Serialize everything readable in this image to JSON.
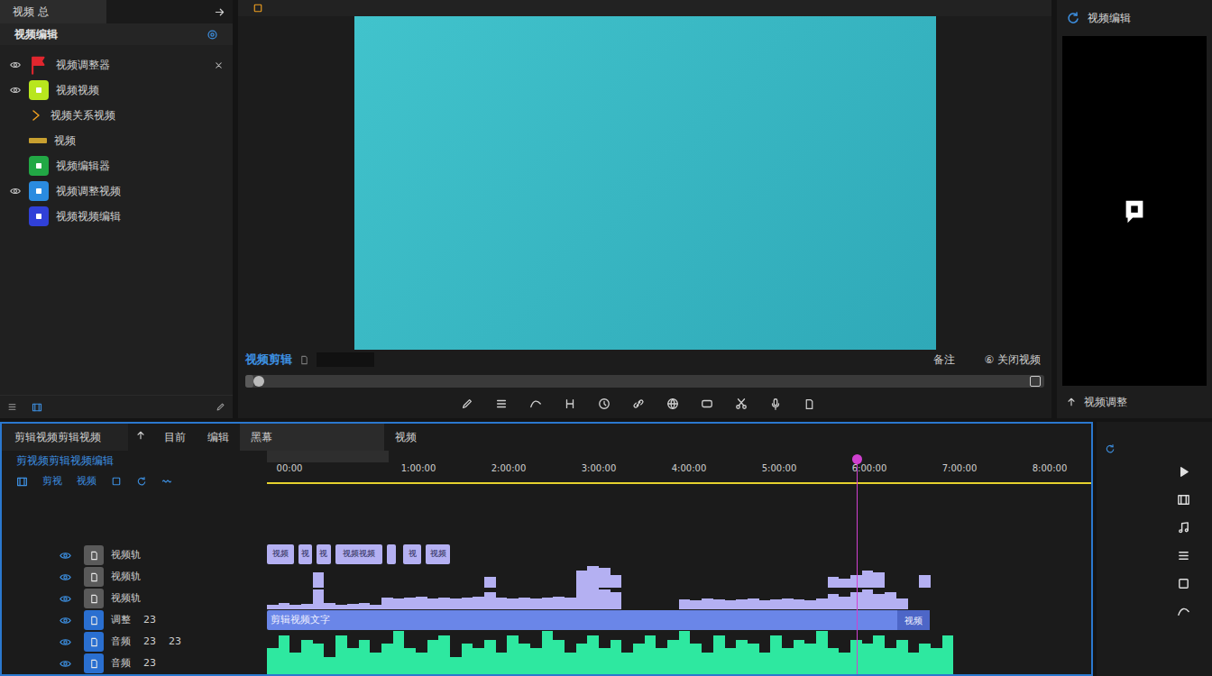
{
  "project_panel": {
    "tab": "视频 总",
    "title": "视频编辑",
    "items": [
      {
        "label": "视频调整器",
        "kind": "flag",
        "color": "#e0262e",
        "visible": true,
        "closable": true
      },
      {
        "label": "视频视频",
        "kind": "badge",
        "color": "#b8e61e",
        "visible": true,
        "closable": false
      },
      {
        "label": "视频关系视频",
        "kind": "arrow",
        "color": "#f0a020",
        "visible": false,
        "closable": false
      },
      {
        "label": "视频",
        "kind": "bar",
        "color": "#c8a030",
        "visible": false,
        "closable": false
      },
      {
        "label": "视频编辑器",
        "kind": "badge",
        "color": "#22a845",
        "visible": false,
        "closable": false
      },
      {
        "label": "视频调整视频",
        "kind": "badge",
        "color": "#2a8be0",
        "visible": true,
        "closable": false
      },
      {
        "label": "视频视频编辑",
        "kind": "badge",
        "color": "#3040d8",
        "visible": false,
        "closable": false
      }
    ]
  },
  "preview": {
    "label": "视频剪辑",
    "notes": "备注",
    "close": "⑥ 关闭视频",
    "scrub_level": 0.01
  },
  "side_panel": {
    "title": "视频编辑",
    "footer": "视频调整"
  },
  "timeline": {
    "title": "剪辑视频剪辑视频",
    "tabs": [
      {
        "label": "目前",
        "selected": false
      },
      {
        "label": "编辑",
        "selected": false
      },
      {
        "label": "黑幕",
        "selected": true
      },
      {
        "label": "视频",
        "selected": false
      }
    ],
    "subtitle": "剪视频剪辑视频编辑",
    "tools": [
      "剪视",
      "视频"
    ],
    "ruler": [
      {
        "time": 0.25,
        "label": "00:00"
      },
      {
        "time": 1.68,
        "label": "1:00:00"
      },
      {
        "time": 2.68,
        "label": "2:00:00"
      },
      {
        "time": 3.68,
        "label": "3:00:00"
      },
      {
        "time": 4.68,
        "label": "4:00:00"
      },
      {
        "time": 5.68,
        "label": "5:00:00"
      },
      {
        "time": 6.68,
        "label": "6:00:00"
      },
      {
        "time": 7.68,
        "label": "7:00:00"
      },
      {
        "time": 8.68,
        "label": "8:00:00"
      }
    ],
    "playhead_level": 0.716,
    "tracks": [
      {
        "kind": "clips",
        "color": "#b4b0f2",
        "headers": [
          {
            "label": "视频轨",
            "color": "#5a5a5a",
            "extra": []
          }
        ],
        "clips": [
          {
            "start": 0,
            "end": 0.3,
            "label": "视频"
          },
          {
            "start": 0.35,
            "end": 0.5,
            "label": "视"
          },
          {
            "start": 0.55,
            "end": 0.71,
            "label": "视"
          },
          {
            "start": 0.76,
            "end": 1.28,
            "label": "视频视频"
          },
          {
            "start": 1.33,
            "end": 1.43,
            "label": ""
          },
          {
            "start": 1.51,
            "end": 1.71,
            "label": "视"
          },
          {
            "start": 1.76,
            "end": 2.03,
            "label": "视频"
          }
        ]
      },
      {
        "kind": "wave",
        "color": "#b4b0f2",
        "headers": [
          {
            "label": "视频轨",
            "color": "#5a5a5a",
            "extra": []
          }
        ],
        "values": [
          0,
          0,
          0,
          0,
          0.7,
          0,
          0,
          0,
          0,
          0,
          0,
          0,
          0,
          0,
          0,
          0,
          0,
          0,
          0,
          0.5,
          0,
          0,
          0,
          0,
          0,
          0,
          0,
          0.8,
          1,
          0.9,
          0.6,
          0,
          0,
          0,
          0,
          0,
          0,
          0,
          0,
          0,
          0,
          0,
          0,
          0,
          0,
          0,
          0,
          0,
          0,
          0.5,
          0.4,
          0.6,
          0.8,
          0.7,
          0,
          0,
          0,
          0.6,
          0,
          0,
          0,
          0,
          0,
          0,
          0,
          0,
          0,
          0,
          0,
          0,
          0,
          0
        ]
      },
      {
        "kind": "wave",
        "color": "#b4b0f2",
        "headers": [
          {
            "label": "视频轨",
            "color": "#5a5a5a",
            "extra": []
          }
        ],
        "values": [
          0.2,
          0.3,
          0.2,
          0.25,
          0.9,
          0.3,
          0.2,
          0.25,
          0.3,
          0.2,
          0.55,
          0.5,
          0.55,
          0.6,
          0.5,
          0.55,
          0.5,
          0.55,
          0.6,
          0.8,
          0.55,
          0.5,
          0.55,
          0.5,
          0.55,
          0.6,
          0.55,
          1,
          1,
          0.9,
          0.8,
          0,
          0,
          0,
          0,
          0,
          0.45,
          0.4,
          0.5,
          0.45,
          0.4,
          0.45,
          0.5,
          0.4,
          0.45,
          0.5,
          0.45,
          0.4,
          0.5,
          0.7,
          0.6,
          0.8,
          0.9,
          0.7,
          0.8,
          0.5,
          0,
          0,
          0,
          0,
          0,
          0,
          0,
          0,
          0,
          0,
          0,
          0,
          0,
          0,
          0,
          0
        ]
      },
      {
        "kind": "bar",
        "color": "#6a86e8",
        "headers": [
          {
            "label": "调整",
            "color": "#2a6fd0",
            "extra": [
              "23"
            ]
          }
        ],
        "start": 0,
        "end": 7.35,
        "label": "剪辑视频文字",
        "tail_label": "视频"
      },
      {
        "kind": "wave",
        "color": "#2ee8a0",
        "headers": [
          {
            "label": "音频",
            "color": "#2a6fd0",
            "extra": [
              "23",
              "23"
            ]
          },
          {
            "label": "音频",
            "color": "#2a6fd0",
            "extra": [
              "23"
            ]
          }
        ],
        "values": [
          0.6,
          0.9,
          0.5,
          0.8,
          0.7,
          0.4,
          0.9,
          0.6,
          0.8,
          0.5,
          0.7,
          1,
          0.6,
          0.5,
          0.8,
          0.9,
          0.4,
          0.7,
          0.6,
          0.8,
          0.5,
          0.9,
          0.7,
          0.6,
          1,
          0.8,
          0.5,
          0.7,
          0.9,
          0.6,
          0.8,
          0.5,
          0.7,
          0.9,
          0.6,
          0.8,
          1,
          0.7,
          0.5,
          0.9,
          0.6,
          0.8,
          0.7,
          0.5,
          0.9,
          0.6,
          0.8,
          0.7,
          1,
          0.6,
          0.5,
          0.8,
          0.7,
          0.9,
          0.6,
          0.8,
          0.5,
          0.7,
          0.6,
          0.9,
          0,
          0,
          0,
          0,
          0,
          0,
          0,
          0,
          0,
          0,
          0,
          0
        ]
      }
    ]
  }
}
